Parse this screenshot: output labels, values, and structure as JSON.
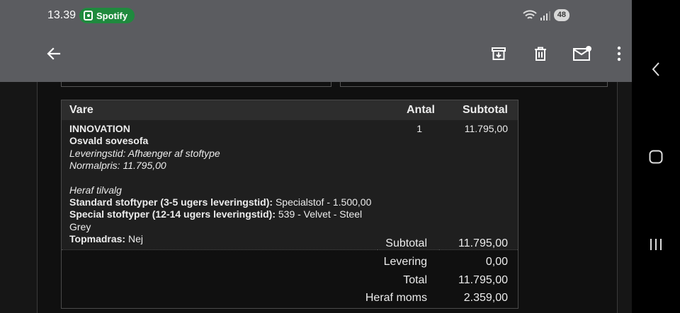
{
  "status_bar": {
    "time": "13.39",
    "spotify_label": "Spotify",
    "battery": "48"
  },
  "app_bar": {
    "back_icon": "arrow-left-icon",
    "actions": [
      "archive-icon",
      "delete-icon",
      "mark-unread-icon",
      "more-vert-icon"
    ]
  },
  "order_table": {
    "headers": {
      "item": "Vare",
      "qty": "Antal",
      "subtotal": "Subtotal"
    },
    "item": {
      "brand": "INNOVATION",
      "name": "Osvald sovesofa",
      "delivery_time": "Leveringstid: Afhænger af stoftype",
      "normal_price": "Normalpris: 11.795,00",
      "options_heading": "Heraf tilvalg",
      "options": [
        {
          "label": "Standard stoftyper (3-5 ugers leveringstid):",
          "value": " Specialstof - 1.500,00"
        },
        {
          "label": "Special stoftyper (12-14 ugers leveringstid):",
          "value": " 539 - Velvet - Steel Grey"
        },
        {
          "label": "Topmadras:",
          "value": " Nej"
        }
      ],
      "qty": "1",
      "subtotal": "11.795,00"
    },
    "totals": [
      {
        "label": "Subtotal",
        "value": "11.795,00"
      },
      {
        "label": "Levering",
        "value": "0,00"
      },
      {
        "label": "Total",
        "value": "11.795,00"
      },
      {
        "label": "Heraf moms",
        "value": "2.359,00"
      }
    ]
  },
  "nav_bar": [
    "chevron-left-icon",
    "home-square-icon",
    "recents-icon"
  ]
}
